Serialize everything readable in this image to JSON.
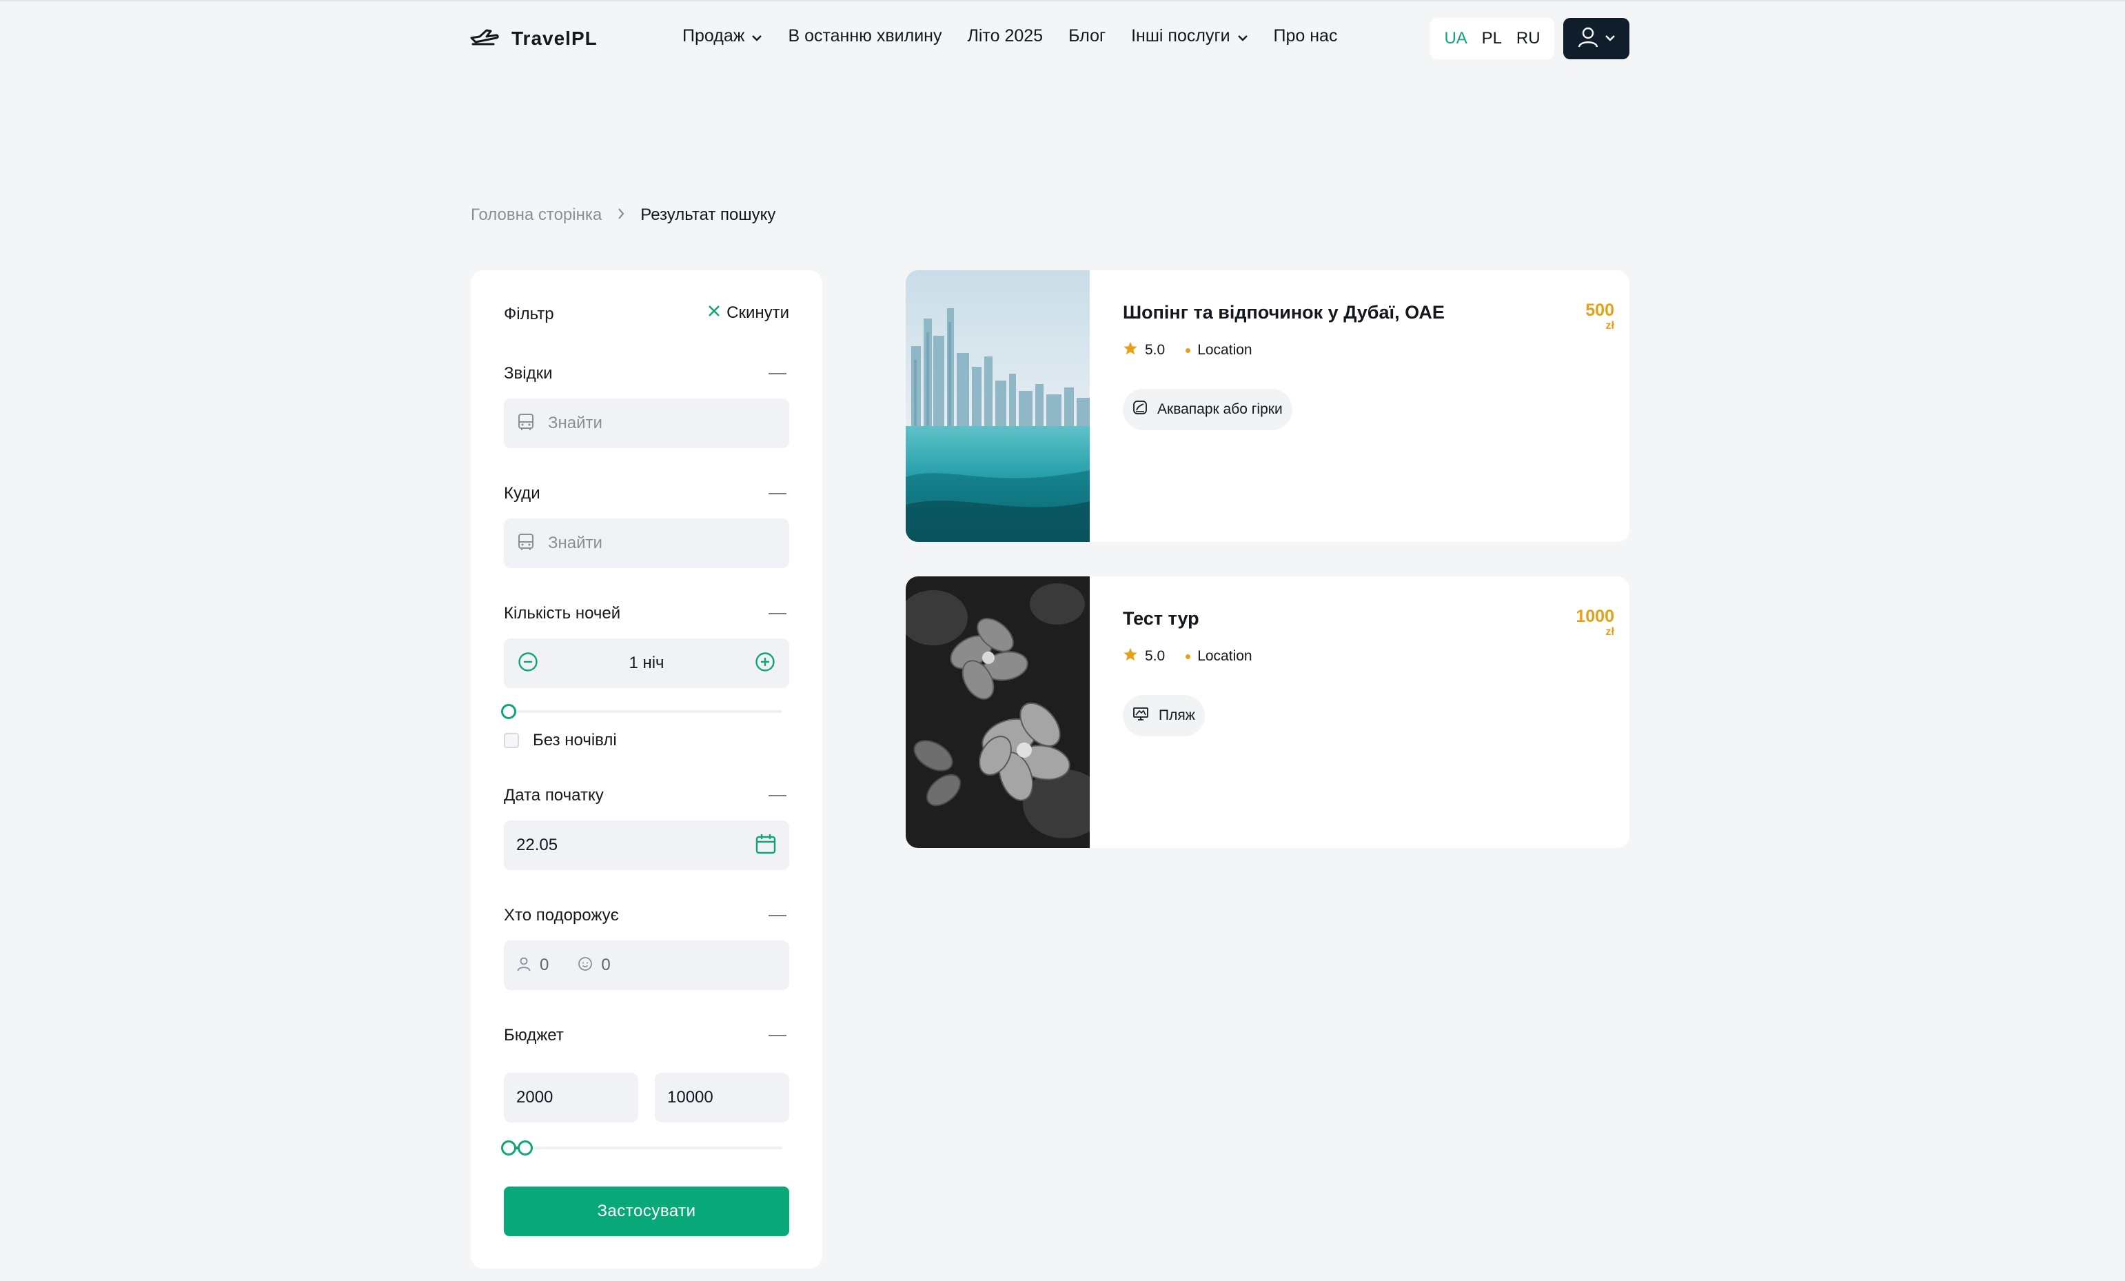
{
  "header": {
    "logo": "TravelPL",
    "nav": [
      {
        "label": "Продаж"
      },
      {
        "label": "В останню хвилину"
      },
      {
        "label": "Літо 2025"
      },
      {
        "label": "Блог"
      },
      {
        "label": "Інші послуги"
      },
      {
        "label": "Про нас"
      }
    ],
    "languages": [
      "UA",
      "PL",
      "RU"
    ],
    "active_language": "UA",
    "accent_color": "#10a578"
  },
  "breadcrumb": {
    "home": "Головна сторінка",
    "current": "Результат пошуку"
  },
  "filter": {
    "title": "Фільтр",
    "reset": "Скинути",
    "from": {
      "label": "Звідки",
      "placeholder": "Знайти"
    },
    "to": {
      "label": "Куди",
      "placeholder": "Знайти"
    },
    "nights": {
      "label": "Кількість ночей",
      "value": "1 ніч",
      "slider_fraction": 0
    },
    "no_overnight": "Без ночівлі",
    "start_date": {
      "label": "Дата початку",
      "value": "22.05"
    },
    "travelers": {
      "label": "Хто подорожує",
      "adults": "0",
      "children": "0"
    },
    "budget": {
      "label": "Бюджет",
      "min": "2000",
      "max": "10000",
      "range_fraction": [
        0,
        0.06
      ]
    },
    "apply": "Застосувати"
  },
  "results": [
    {
      "title": "Шопінг та відпочинок у Дубаї, ОАЕ",
      "rating": "5.0",
      "location": "Location",
      "tag": "Аквапарк або гірки",
      "price": "500",
      "currency": "zł"
    },
    {
      "title": "Тест тур",
      "rating": "5.0",
      "location": "Location",
      "tag": "Пляж",
      "price": "1000",
      "currency": "zł"
    }
  ]
}
